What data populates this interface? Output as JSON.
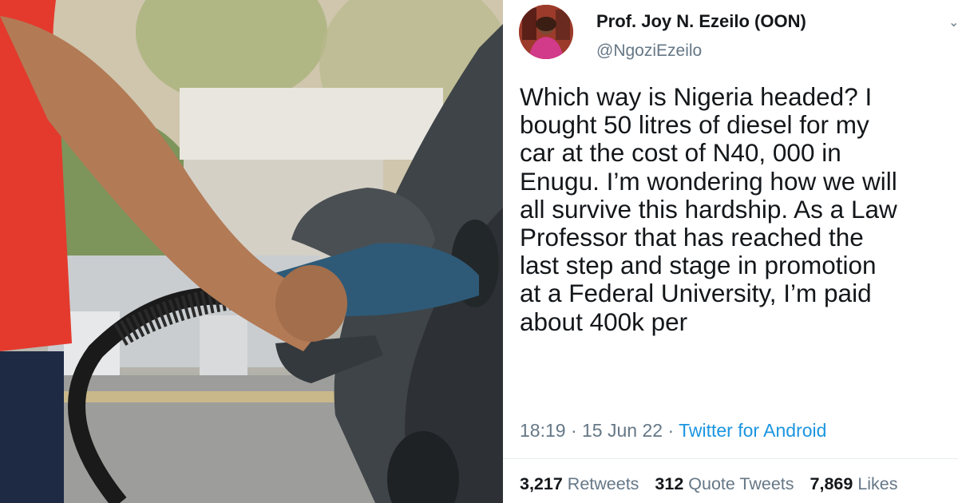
{
  "tweet": {
    "display_name": "Prof. Joy N. Ezeilo (OON)",
    "handle": "@NgoziEzeilo",
    "text": "Which way is Nigeria headed? I\nbought 50 litres of diesel for my\ncar at the cost of N40, 000 in\nEnugu.  I’m wondering how we will\nall survive this hardship. As a Law\nProfessor that has reached the\nlast step and stage in promotion\nat a Federal University, I’m paid\nabout 400k per",
    "time": "18:19",
    "date": "15 Jun 22",
    "separator": "·",
    "source": "Twitter for Android",
    "retweets": "3,217",
    "retweets_label": "Retweets",
    "quote_tweets": "312",
    "quote_tweets_label": "Quote Tweets",
    "likes": "7,869",
    "likes_label": "Likes",
    "avatar_icon": "profile-photo",
    "more_icon": "chevron-down-icon"
  },
  "photo": {
    "subject": "fuel-pump-nozzle-photo"
  },
  "colors": {
    "text_primary": "#14171a",
    "text_secondary": "#657786",
    "link": "#1b95e0",
    "divider": "#e6ecf0"
  }
}
